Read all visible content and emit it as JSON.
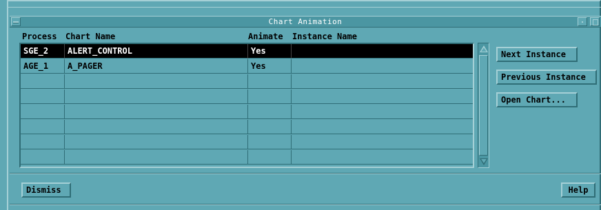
{
  "window": {
    "title": "Chart Animation"
  },
  "columns": [
    "Process",
    "Chart Name",
    "Animate",
    "Instance Name"
  ],
  "rows": [
    {
      "process": "SGE_2",
      "chart_name": "ALERT_CONTROL",
      "animate": "Yes",
      "instance_name": "",
      "selected": true
    },
    {
      "process": "AGE_1",
      "chart_name": "A_PAGER",
      "animate": "Yes",
      "instance_name": "",
      "selected": false
    },
    {
      "process": "",
      "chart_name": "",
      "animate": "",
      "instance_name": "",
      "selected": false
    },
    {
      "process": "",
      "chart_name": "",
      "animate": "",
      "instance_name": "",
      "selected": false
    },
    {
      "process": "",
      "chart_name": "",
      "animate": "",
      "instance_name": "",
      "selected": false
    },
    {
      "process": "",
      "chart_name": "",
      "animate": "",
      "instance_name": "",
      "selected": false
    },
    {
      "process": "",
      "chart_name": "",
      "animate": "",
      "instance_name": "",
      "selected": false
    },
    {
      "process": "",
      "chart_name": "",
      "animate": "",
      "instance_name": "",
      "selected": false
    }
  ],
  "buttons": {
    "next_instance": "Next Instance",
    "previous_instance": "Previous Instance",
    "open_chart": "Open Chart...",
    "dismiss": "Dismiss",
    "help": "Help"
  },
  "icons": {
    "window_menu": "window-menu-icon",
    "minimize": "minimize-icon",
    "maximize": "maximize-icon",
    "scroll_up": "scroll-up-arrow-icon",
    "scroll_down": "scroll-down-arrow-icon"
  },
  "colors": {
    "background": "#5fa8b4",
    "title_bar": "#4b96a2",
    "highlight": "#a5d0d6",
    "shadow": "#2f6d76",
    "selected_row": "#000000",
    "selected_text": "#ffffff"
  }
}
